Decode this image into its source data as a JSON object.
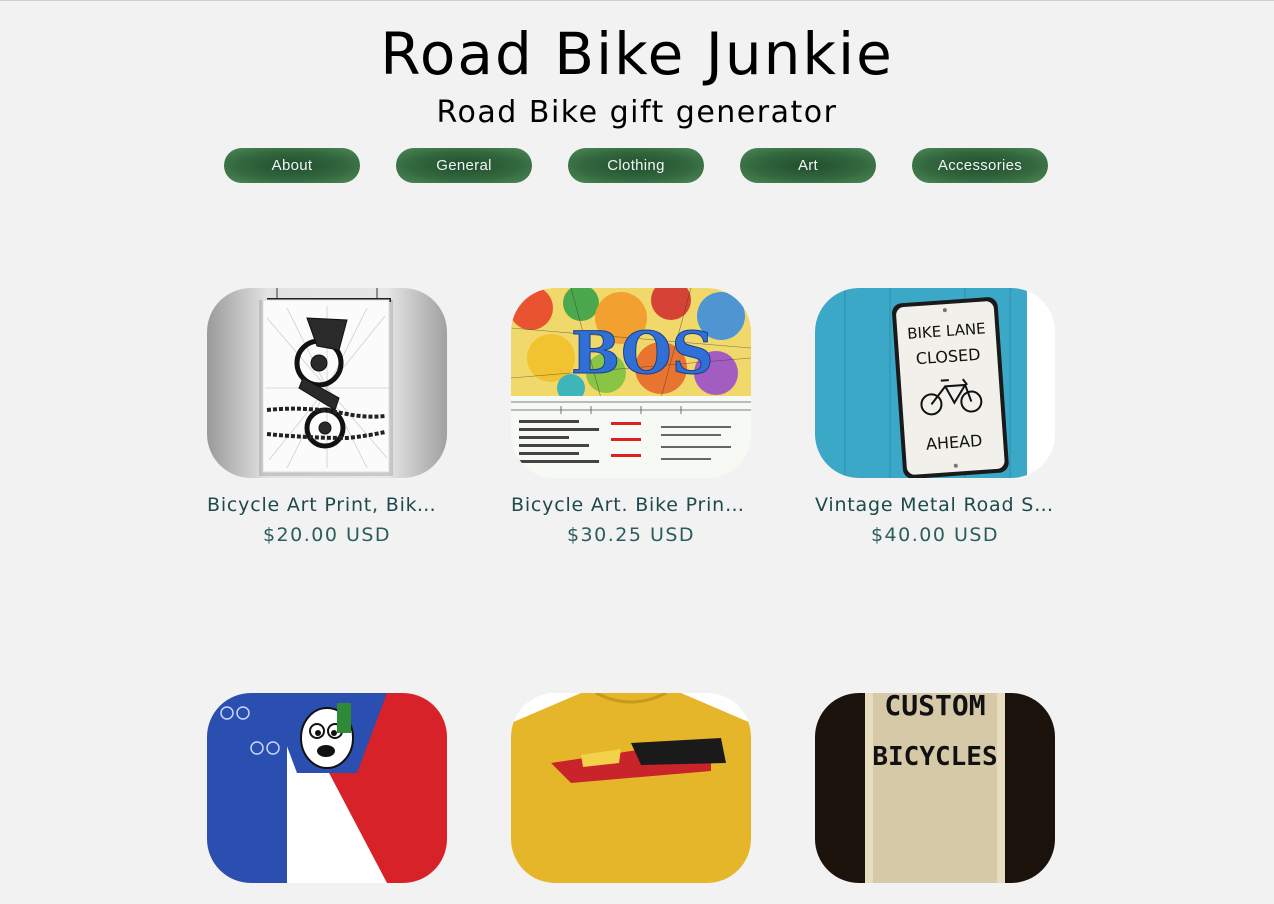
{
  "site": {
    "title": "Road Bike Junkie",
    "subtitle": "Road Bike gift generator"
  },
  "nav": [
    {
      "label": "About"
    },
    {
      "label": "General"
    },
    {
      "label": "Clothing"
    },
    {
      "label": "Art"
    },
    {
      "label": "Accessories"
    }
  ],
  "products": [
    {
      "title": "Bicycle Art Print, Bike ...",
      "price": "$20.00 USD"
    },
    {
      "title": "Bicycle Art. Bike Print. ...",
      "price": "$30.25 USD"
    },
    {
      "title": "Vintage Metal Road Si...",
      "price": "$40.00 USD"
    },
    {
      "title": "",
      "price": ""
    },
    {
      "title": "",
      "price": ""
    },
    {
      "title": "",
      "price": ""
    }
  ],
  "image_text": {
    "map_letters": "BOS",
    "sign_line1": "BIKE LANE",
    "sign_line2": "CLOSED",
    "sign_line3": "AHEAD",
    "custom_line1": "CUSTOM",
    "custom_line2": "BICYCLES"
  },
  "colors": {
    "nav_button": "#33673e",
    "product_title": "#1d4a4a",
    "product_price": "#2c5c5a",
    "background": "#f2f2f2"
  }
}
